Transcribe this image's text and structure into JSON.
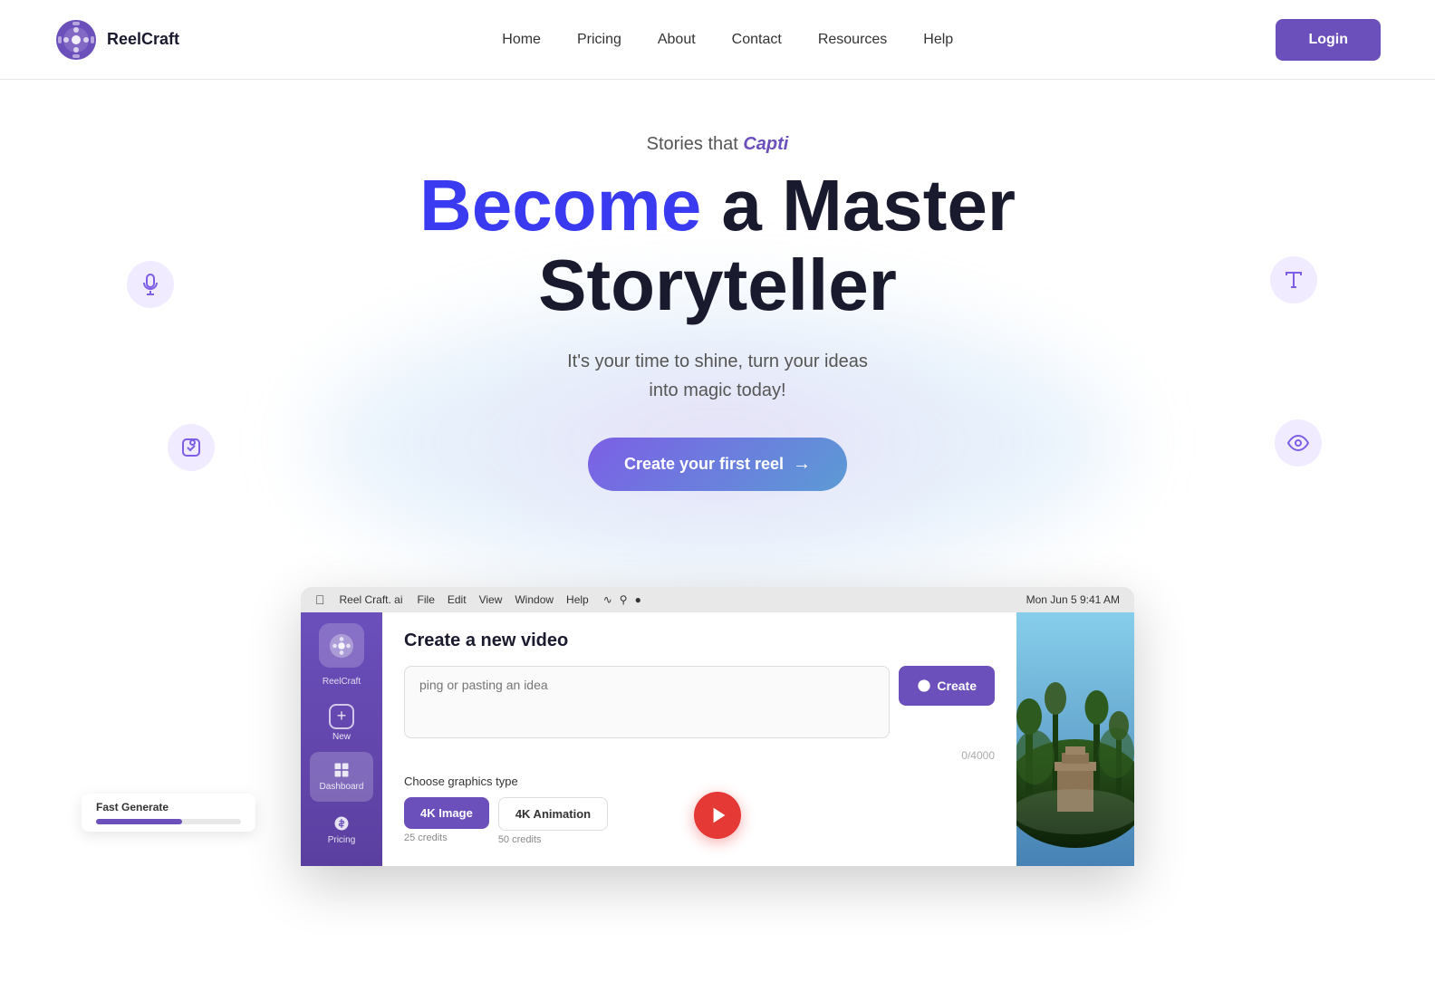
{
  "navbar": {
    "logo_text": "ReelCraft",
    "nav_links": [
      {
        "label": "Home",
        "id": "home"
      },
      {
        "label": "Pricing",
        "id": "pricing"
      },
      {
        "label": "About",
        "id": "about"
      },
      {
        "label": "Contact",
        "id": "contact"
      },
      {
        "label": "Resources",
        "id": "resources"
      },
      {
        "label": "Help",
        "id": "help"
      }
    ],
    "login_label": "Login"
  },
  "hero": {
    "subtitle_prefix": "Stories that ",
    "subtitle_highlight": "Capti",
    "title_highlight": "Become",
    "title_rest": " a Master Storyteller",
    "description_line1": "It's your time to shine, turn your ideas",
    "description_line2": "into magic today!",
    "cta_label": "Create your first reel"
  },
  "app_preview": {
    "menubar": {
      "app_name": "Reel Craft. ai",
      "menus": [
        "File",
        "Edit",
        "View",
        "Window",
        "Help"
      ],
      "time": "Mon Jun 5 9:41 AM"
    },
    "sidebar_items": [
      {
        "label": "New",
        "icon": "plus"
      },
      {
        "label": "Dashboard",
        "icon": "grid"
      },
      {
        "label": "Pricing",
        "icon": "tag"
      }
    ],
    "main": {
      "title": "Create a new video",
      "input_placeholder": "ping or pasting an idea",
      "char_count": "0/4000",
      "create_label": "Create",
      "graphics_label": "Choose graphics type",
      "graphics_options": [
        {
          "label": "4K Image",
          "credits": "25 credits",
          "active": true
        },
        {
          "label": "4K Animation",
          "credits": "50 credits",
          "active": false
        }
      ]
    },
    "fast_generate": {
      "label": "Fast Generate"
    }
  },
  "colors": {
    "primary": "#6b4fbb",
    "primary_dark": "#5b3fa0",
    "accent_blue": "#3a3af0",
    "red": "#e53935",
    "white": "#ffffff"
  }
}
